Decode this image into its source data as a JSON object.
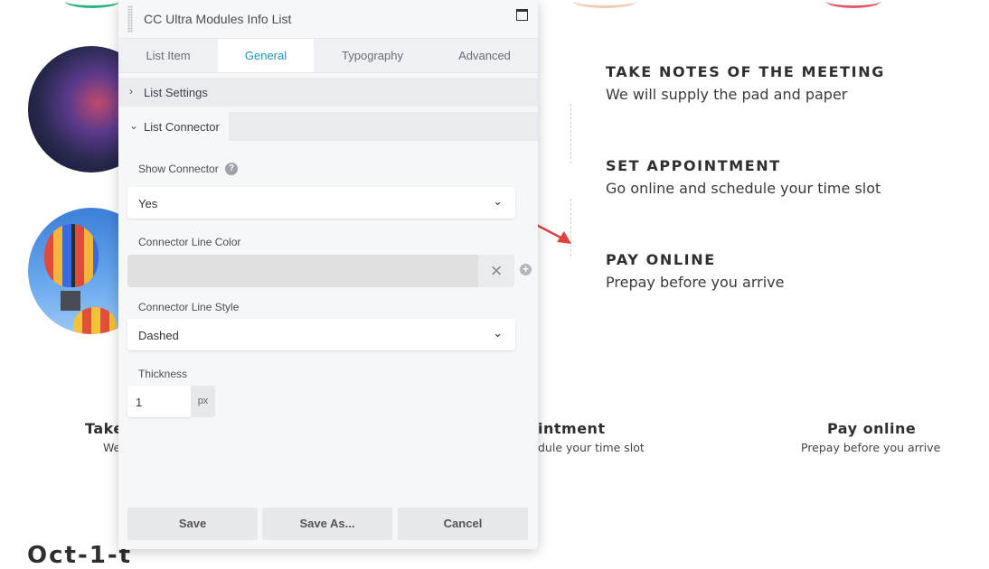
{
  "panel": {
    "title": "CC Ultra Modules Info List",
    "tabs": [
      "List Item",
      "General",
      "Typography",
      "Advanced"
    ],
    "active_tab": "General",
    "sections": {
      "list_settings": "List Settings",
      "list_connector": "List Connector"
    },
    "fields": {
      "show_connector": {
        "label": "Show Connector",
        "value": "Yes"
      },
      "connector_line_color": {
        "label": "Connector Line Color",
        "value": ""
      },
      "connector_line_style": {
        "label": "Connector Line Style",
        "value": "Dashed"
      },
      "thickness": {
        "label": "Thickness",
        "value": "1",
        "unit": "px"
      }
    },
    "buttons": {
      "save": "Save",
      "save_as": "Save As...",
      "cancel": "Cancel"
    }
  },
  "page": {
    "steps": [
      {
        "title": "TAKE NOTES OF THE MEETING",
        "desc": "We will supply the pad and paper"
      },
      {
        "title": "SET APPOINTMENT",
        "desc": "Go online and schedule your time slot"
      },
      {
        "title": "PAY ONLINE",
        "desc": "Prepay before you arrive"
      }
    ],
    "bottom": [
      {
        "title": "Take",
        "desc": "We"
      },
      {
        "title": "intment",
        "desc": "dule your time slot"
      },
      {
        "title": "Pay online",
        "desc": "Prepay before you arrive"
      }
    ],
    "footer_heading": "Oct-1-t"
  },
  "colors": {
    "accent": "#1e93b4",
    "arrow": "#e0413c"
  }
}
